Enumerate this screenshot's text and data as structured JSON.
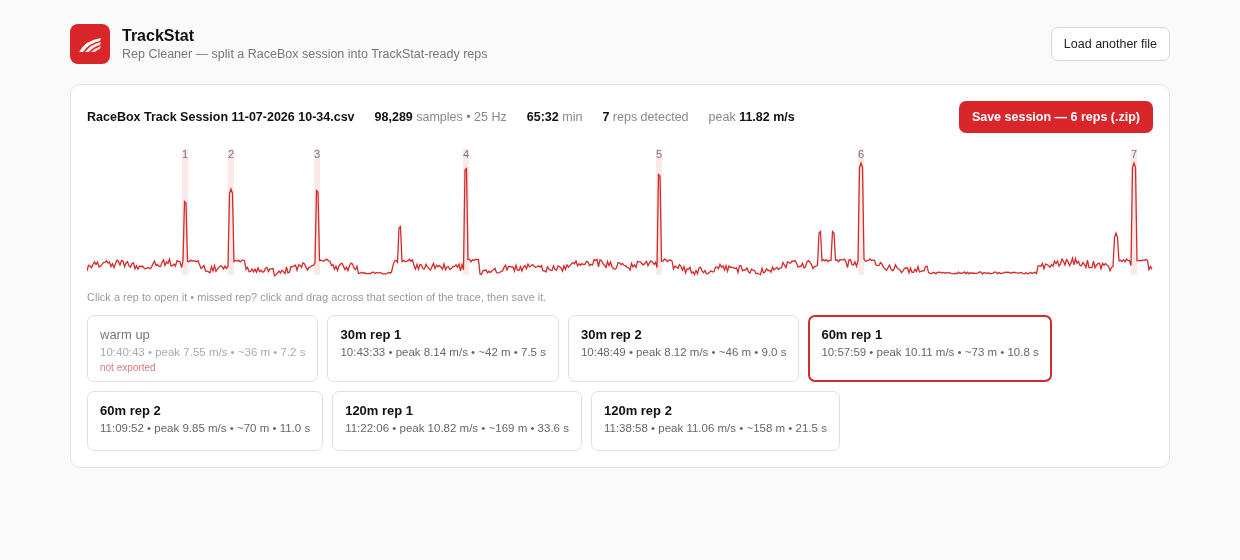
{
  "app": {
    "title": "TrackStat",
    "subtitle": "Rep Cleaner — split a RaceBox session into TrackStat-ready reps"
  },
  "load_button": "Load another file",
  "session": {
    "filename": "RaceBox Track Session 11-07-2026 10-34.csv",
    "stats": [
      "**98,289** samples • 25 Hz",
      "**65:32** min",
      "**7** reps detected",
      "peak **11.82 m/s**"
    ],
    "save_button": "Save session — 6 reps (.zip)"
  },
  "trace": {
    "markers": [
      "1",
      "2",
      "3",
      "4",
      "5",
      "6",
      "7"
    ],
    "hint": "Click a rep to open it • missed rep? click and drag across that section of the trace, then save it."
  },
  "reps": [
    {
      "title": "warm up",
      "meta": "10:40:43 • peak 7.55 m/s • ~36 m • 7.2 s",
      "exported": false,
      "note": "not exported",
      "selected": false
    },
    {
      "title": "30m rep 1",
      "meta": "10:43:33 • peak 8.14 m/s • ~42 m • 7.5 s",
      "exported": true,
      "selected": false
    },
    {
      "title": "30m rep 2",
      "meta": "10:48:49 • peak 8.12 m/s • ~46 m • 9.0 s",
      "exported": true,
      "selected": false
    },
    {
      "title": "60m rep 1",
      "meta": "10:57:59 • peak 10.11 m/s • ~73 m • 10.8 s",
      "exported": true,
      "selected": true
    },
    {
      "title": "60m rep 2",
      "meta": "11:09:52 • peak 9.85 m/s • ~70 m • 11.0 s",
      "exported": true,
      "selected": false
    },
    {
      "title": "120m rep 1",
      "meta": "11:22:06 • peak 10.82 m/s • ~169 m • 33.6 s",
      "exported": true,
      "selected": false
    },
    {
      "title": "120m rep 2",
      "meta": "11:38:58 • peak 11.06 m/s • ~158 m • 21.5 s",
      "exported": true,
      "selected": false
    }
  ]
}
